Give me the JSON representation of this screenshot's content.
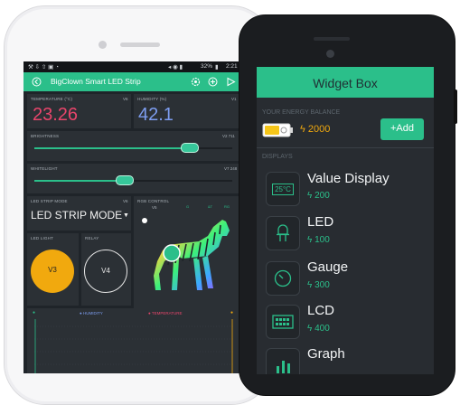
{
  "iphone": {
    "status": {
      "percent": "32%",
      "time": "2:21"
    },
    "app": {
      "title": "BigClown Smart LED Strip"
    },
    "temperature": {
      "label": "TEMPERATURE (°C)",
      "pin": "V6",
      "value": "23.26",
      "color": "#e8456b"
    },
    "humidity": {
      "label": "HUMIDITY (%)",
      "pin": "V1",
      "value": "42.1",
      "color": "#7d9df0"
    },
    "brightness": {
      "label": "BRIGHTNESS",
      "pin": "V2 711",
      "level": 0.78
    },
    "whitelight": {
      "label": "WHITELIGHT",
      "pin": "V7 248",
      "level": 0.45
    },
    "led_mode": {
      "label": "LED STRIP MODE",
      "pin": "V6",
      "value": "LED STRIP MODE"
    },
    "rgb": {
      "label": "RGB CONTROL",
      "pin": "V5"
    },
    "led_light": {
      "label": "LED LIGHT",
      "button": "V3"
    },
    "relay": {
      "label": "RELAY",
      "button": "V4"
    },
    "graph": {
      "humidity_label": "HUMIDITY",
      "temperature_label": "TEMPERATURE"
    }
  },
  "widget_box": {
    "title": "Widget Box",
    "energy_label": "YOUR ENERGY BALANCE",
    "energy_value": "2000",
    "add_label": "+Add",
    "displays_label": "DISPLAYS",
    "items": [
      {
        "name": "Value Display",
        "cost": "200",
        "icon": "25°C"
      },
      {
        "name": "LED",
        "cost": "100",
        "icon": "led-icon"
      },
      {
        "name": "Gauge",
        "cost": "300",
        "icon": "gauge-icon"
      },
      {
        "name": "LCD",
        "cost": "400",
        "icon": "lcd-icon"
      },
      {
        "name": "Graph",
        "cost": "",
        "icon": "graph-icon"
      }
    ]
  }
}
